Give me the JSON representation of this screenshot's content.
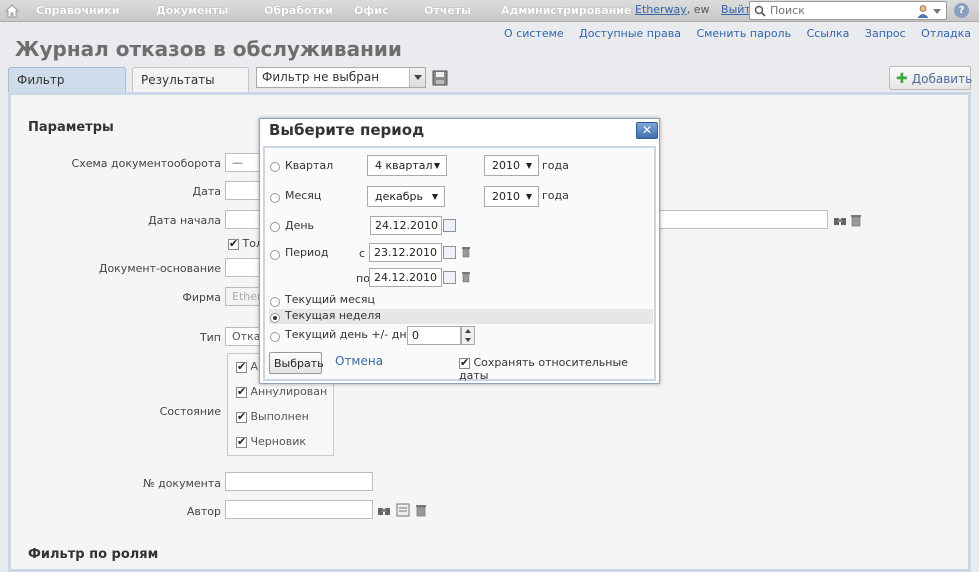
{
  "topbar": {
    "menu": [
      "Справочники",
      "Документы",
      "Обработки",
      "Офис",
      "Отчёты",
      "Администрирование"
    ],
    "user_name": "Etherway",
    "user_suffix": ", ew",
    "logout": "Выйти",
    "search_placeholder": "Поиск",
    "help": "?"
  },
  "toplinks": [
    "О системе",
    "Доступные права",
    "Сменить пароль",
    "Ссылка",
    "Запрос",
    "Отладка"
  ],
  "page_title": "Журнал отказов в обслуживании",
  "tabs": {
    "filter": "Фильтр",
    "results": "Результаты"
  },
  "filter_select": "Фильтр не выбран",
  "add_button": "Добавить",
  "params": {
    "heading": "Параметры",
    "labels": {
      "doc_flow": "Схема документооборота",
      "date": "Дата",
      "date_start": "Дата начала",
      "base_doc": "Документ-основание",
      "firm": "Фирма",
      "type": "Тип",
      "state": "Состояние",
      "doc_number": "№ документа",
      "author": "Автор"
    },
    "doc_flow_value": "—",
    "only_label_partial": "Тол",
    "firm_value_partial": "Ether",
    "type_value_partial": "Отка",
    "states": [
      {
        "label": "Ан",
        "checked": true
      },
      {
        "label": "Аннулирован",
        "checked": true
      },
      {
        "label": "Выполнен",
        "checked": true
      },
      {
        "label": "Черновик",
        "checked": true
      }
    ],
    "roles_heading": "Фильтр по ролям"
  },
  "dialog": {
    "title": "Выберите период",
    "close": "✕",
    "quarter_label": "Квартал",
    "quarter_value": "4 квартал",
    "quarter_year": "2010",
    "year_suffix": "года",
    "month_label": "Месяц",
    "month_value": "декабрь",
    "month_year": "2010",
    "day_label": "День",
    "day_value": "24.12.2010",
    "period_label": "Период",
    "from_label": "с",
    "from_value": "23.12.2010",
    "to_label": "по",
    "to_value": "24.12.2010",
    "current_month": "Текущий месяц",
    "current_week": "Текущая неделя",
    "current_day": "Текущий день +/- дней:",
    "day_offset": "0",
    "select_button": "Выбрать",
    "cancel_link": "Отмена",
    "keep_relative": "Сохранять относительные даты",
    "selected_option": "current_week"
  }
}
